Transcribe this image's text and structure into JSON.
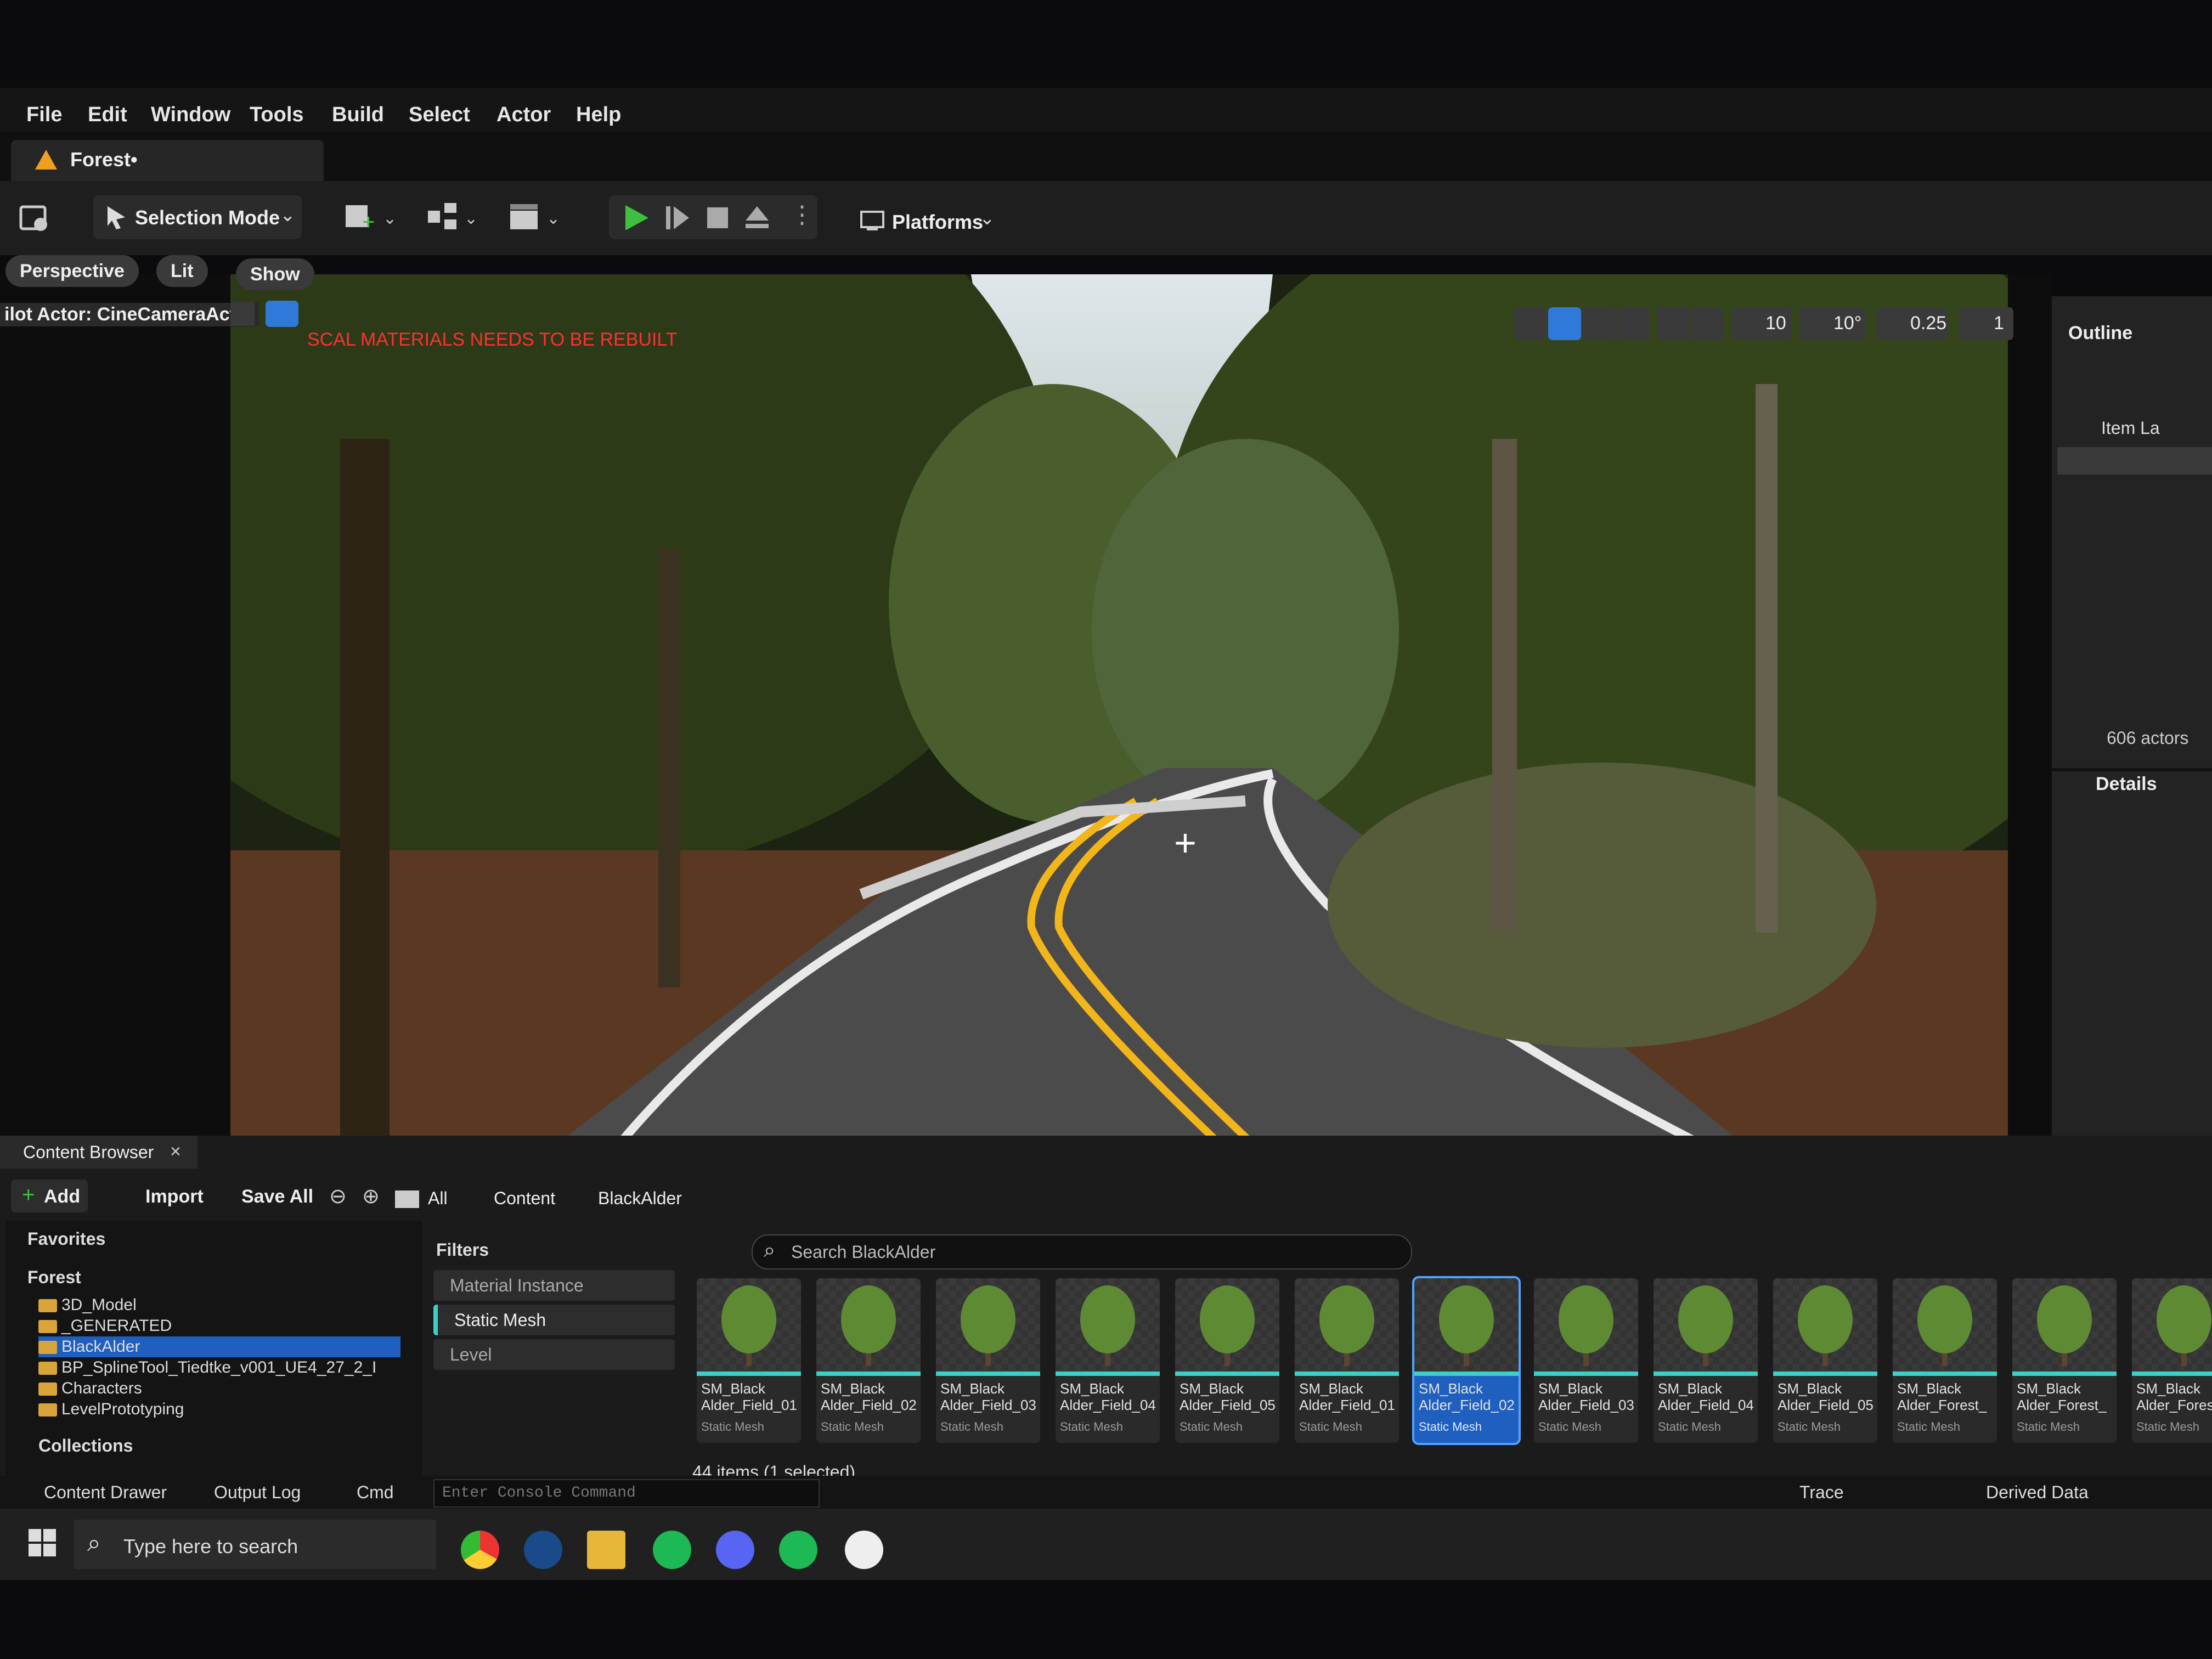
{
  "menu": [
    "File",
    "Edit",
    "Window",
    "Tools",
    "Build",
    "Select",
    "Actor",
    "Help"
  ],
  "level_tab": "Forest•",
  "toolbar": {
    "selection_mode": "Selection Mode",
    "platforms": "Platforms"
  },
  "viewport": {
    "perspective": "Perspective",
    "lit": "Lit",
    "show": "Show",
    "pilot_actor": "ilot Actor: CineCameraActor",
    "warning": "SCAL MATERIALS NEEDS TO BE REBUILT",
    "grid_snap": "10",
    "rotation_snap": "10°",
    "scale_snap": "0.25",
    "camera_speed": "1"
  },
  "outliner": {
    "title": "Outline",
    "item_label": "Item La",
    "actors_count": "606 actors",
    "details": "Details"
  },
  "content_browser": {
    "tab_title": "Content Browser",
    "add": "Add",
    "import": "Import",
    "save_all": "Save All",
    "path": [
      "All",
      "Content",
      "BlackAlder"
    ],
    "favorites": "Favorites",
    "forest": "Forest",
    "collections": "Collections",
    "tree": [
      "3D_Model",
      "_GENERATED",
      "BlackAlder",
      "BP_SplineTool_Tiedtke_v001_UE4_27_2_I",
      "Characters",
      "LevelPrototyping"
    ],
    "filters_title": "Filters",
    "filters": [
      "Material Instance",
      "Static Mesh",
      "Level"
    ],
    "search_placeholder": "Search BlackAlder",
    "items_status": "44 items (1 selected)",
    "assets": [
      {
        "name": "SM_Black Alder_Field_01",
        "type": "Static Mesh"
      },
      {
        "name": "SM_Black Alder_Field_02",
        "type": "Static Mesh"
      },
      {
        "name": "SM_Black Alder_Field_03",
        "type": "Static Mesh"
      },
      {
        "name": "SM_Black Alder_Field_04",
        "type": "Static Mesh"
      },
      {
        "name": "SM_Black Alder_Field_05",
        "type": "Static Mesh"
      },
      {
        "name": "SM_Black Alder_Field_01",
        "type": "Static Mesh"
      },
      {
        "name": "SM_Black Alder_Field_02",
        "type": "Static Mesh"
      },
      {
        "name": "SM_Black Alder_Field_03",
        "type": "Static Mesh"
      },
      {
        "name": "SM_Black Alder_Field_04",
        "type": "Static Mesh"
      },
      {
        "name": "SM_Black Alder_Field_05",
        "type": "Static Mesh"
      },
      {
        "name": "SM_Black Alder_Forest_",
        "type": "Static Mesh"
      },
      {
        "name": "SM_Black Alder_Forest_",
        "type": "Static Mesh"
      },
      {
        "name": "SM_Black Alder_Forest_",
        "type": "Static Mesh"
      }
    ]
  },
  "bottom_bar": {
    "content_drawer": "Content Drawer",
    "output_log": "Output Log",
    "cmd": "Cmd",
    "console_placeholder": "Enter Console Command",
    "trace": "Trace",
    "derived_data": "Derived Data"
  },
  "taskbar": {
    "search_placeholder": "Type here to search"
  },
  "colors": {
    "accent_green": "#3fbf3f",
    "selection_blue": "#1f5fbf",
    "mesh_bar": "#3ad1c8",
    "warning_red": "#ff3030",
    "folder": "#d9a53b"
  }
}
